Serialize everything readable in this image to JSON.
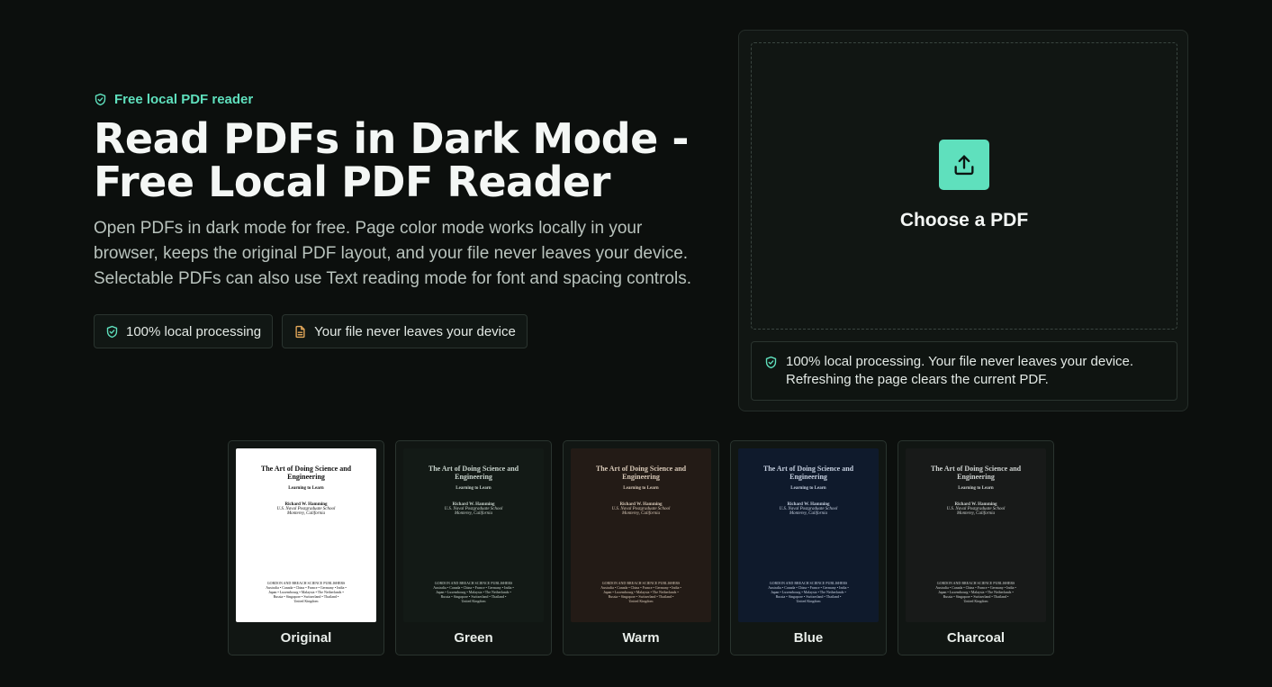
{
  "hero": {
    "eyebrow": "Free local PDF reader",
    "title_line1": "Read PDFs in Dark Mode -",
    "title_line2": "Free Local PDF Reader",
    "description_line1": "Open PDFs in dark mode for free. Page color mode works locally in your",
    "description_line2": "browser, keeps the original PDF layout, and your file never leaves your device.",
    "description_line3": "Selectable PDFs can also use Text reading mode for font and spacing controls.",
    "chips": [
      {
        "label": "100% local processing",
        "icon": "shield-check-icon"
      },
      {
        "label": "Your file never leaves your device",
        "icon": "document-icon"
      }
    ]
  },
  "upload": {
    "choose_label": "Choose a PDF",
    "icon": "upload-icon",
    "notice_line1": "100% local processing. Your file never leaves your device.",
    "notice_line2": "Refreshing the page clears the current PDF."
  },
  "preview_doc": {
    "title_line1": "The Art of Doing Science and",
    "title_line2": "Engineering",
    "subtitle": "Learning to Learn",
    "author": "Richard W. Hamming",
    "affiliation_line1": "U.S. Naval Postgraduate School",
    "affiliation_line2": "Monterey, California",
    "publisher": "GORDON AND BREACH SCIENCE PUBLISHERS",
    "publisher_line2": "Australia • Canada • China • France • Germany • India •",
    "publisher_line3": "Japan • Luxembourg • Malaysia • The Netherlands •",
    "publisher_line4": "Russia • Singapore • Switzerland • Thailand •",
    "publisher_line5": "United Kingdom"
  },
  "themes": [
    {
      "name": "Original",
      "bg": "#ffffff",
      "fg": "#111111"
    },
    {
      "name": "Green",
      "bg": "#131a16",
      "fg": "#c9d4cd"
    },
    {
      "name": "Warm",
      "bg": "#231b16",
      "fg": "#d8c9b8"
    },
    {
      "name": "Blue",
      "bg": "#0f1a2c",
      "fg": "#c6d0e0"
    },
    {
      "name": "Charcoal",
      "bg": "#181a19",
      "fg": "#cfd3d1"
    }
  ],
  "colors": {
    "accent": "#5fe0bd",
    "background": "#0c0f0d",
    "document_icon": "#e3a85a"
  }
}
